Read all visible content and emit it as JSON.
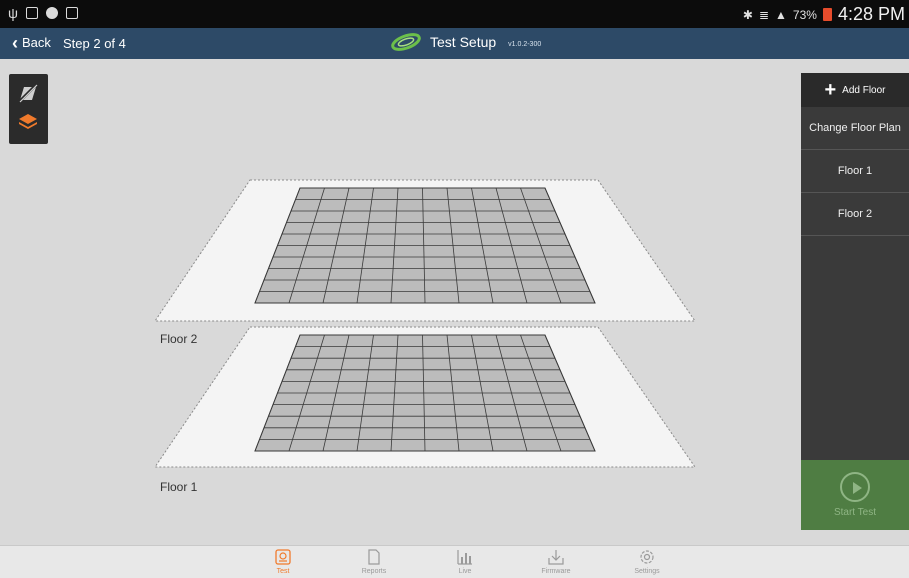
{
  "status_bar": {
    "battery": "73%",
    "time": "4:28 PM"
  },
  "header": {
    "back_label": "Back",
    "step": "Step 2 of 4",
    "title": "Test Setup",
    "version": "v1.0.2-300",
    "brand_color": "#2d4a67",
    "logo_color": "#6cc04a"
  },
  "right_panel": {
    "add_floor": "Add Floor",
    "change_floor_plan": "Change Floor Plan",
    "floors": [
      "Floor 1",
      "Floor 2"
    ],
    "start_test": "Start Test"
  },
  "canvas": {
    "floors": [
      {
        "label": "Floor 2"
      },
      {
        "label": "Floor 1"
      }
    ]
  },
  "bottom_nav": {
    "active_color": "#f07a2c",
    "items": [
      {
        "label": "Test",
        "icon": "test-icon",
        "active": true
      },
      {
        "label": "Reports",
        "icon": "reports-icon",
        "active": false
      },
      {
        "label": "Live",
        "icon": "live-icon",
        "active": false
      },
      {
        "label": "Firmware",
        "icon": "firmware-icon",
        "active": false
      },
      {
        "label": "Settings",
        "icon": "settings-icon",
        "active": false
      }
    ]
  }
}
